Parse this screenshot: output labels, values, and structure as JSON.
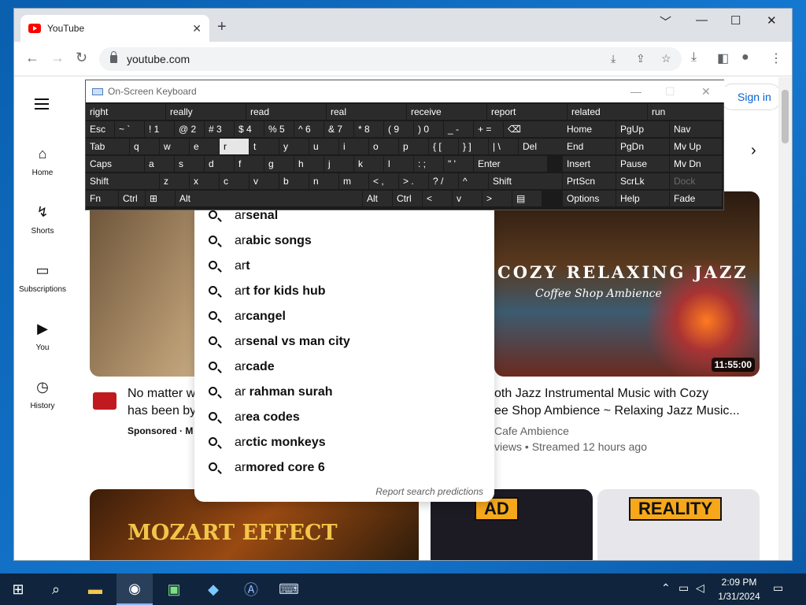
{
  "browser": {
    "tab_title": "YouTube",
    "tab_close": "✕",
    "new_tab": "+",
    "url": "youtube.com",
    "minimize": "﹀",
    "restore_down": "—",
    "maximize": "☐",
    "close": "✕"
  },
  "youtube": {
    "sign_in": "Sign in",
    "sidebar": [
      {
        "label": "Home",
        "icon": "home-icon"
      },
      {
        "label": "Shorts",
        "icon": "shorts-icon"
      },
      {
        "label": "Subscriptions",
        "icon": "subscriptions-icon"
      },
      {
        "label": "You",
        "icon": "you-icon"
      },
      {
        "label": "History",
        "icon": "history-icon"
      }
    ],
    "videos": [
      {
        "title_line1": "No matter w",
        "title_line2": "has been by",
        "meta": "Sponsored · M"
      },
      {
        "thumb_title": "COZY RELAXING JAZZ",
        "thumb_sub": "Coffee Shop Ambience",
        "duration": "11:55:00",
        "title_line1": "oth Jazz Instrumental Music with Cozy",
        "title_line2": "ee Shop Ambience ~ Relaxing Jazz Music...",
        "channel": "Cafe Ambience",
        "meta": "views • Streamed 12 hours ago"
      },
      {
        "thumb_text": "MOZART EFFECT"
      },
      {
        "badge": "AD"
      },
      {
        "badge": "REALITY"
      }
    ],
    "suggestions": [
      {
        "typed": "ar",
        "rest": "senal"
      },
      {
        "typed": "ar",
        "rest": "abic songs"
      },
      {
        "typed": "ar",
        "rest": "t"
      },
      {
        "typed": "ar",
        "rest": "t for kids hub"
      },
      {
        "typed": "ar",
        "rest": "cangel"
      },
      {
        "typed": "ar",
        "rest": "senal vs man city"
      },
      {
        "typed": "ar",
        "rest": "cade"
      },
      {
        "typed": "ar",
        "rest": " rahman surah"
      },
      {
        "typed": "ar",
        "rest": "ea codes"
      },
      {
        "typed": "ar",
        "rest": "ctic monkeys"
      },
      {
        "typed": "ar",
        "rest": "mored core 6"
      }
    ],
    "report": "Report search predictions"
  },
  "osk": {
    "title": "On-Screen Keyboard",
    "predictions": [
      "right",
      "really",
      "read",
      "real",
      "receive",
      "report",
      "related",
      "run"
    ],
    "row1": [
      "Esc",
      "~ `",
      "! 1",
      "@ 2",
      "# 3",
      "$ 4",
      "% 5",
      "^ 6",
      "& 7",
      "* 8",
      "( 9",
      ") 0",
      "_ -",
      "+ =",
      "⌫"
    ],
    "row2": [
      "Tab",
      "q",
      "w",
      "e",
      "r",
      "t",
      "y",
      "u",
      "i",
      "o",
      "p",
      "{ [",
      "} ]",
      "| \\",
      "Del"
    ],
    "row3": [
      "Caps",
      "a",
      "s",
      "d",
      "f",
      "g",
      "h",
      "j",
      "k",
      "l",
      ": ;",
      "\" '",
      "Enter"
    ],
    "row4": [
      "Shift",
      "z",
      "x",
      "c",
      "v",
      "b",
      "n",
      "m",
      "< ,",
      "> .",
      "? /",
      "^",
      "Shift"
    ],
    "row5": [
      "Fn",
      "Ctrl",
      "⊞",
      "Alt",
      "Alt",
      "Ctrl",
      "<",
      "v",
      ">",
      "▤"
    ],
    "nav": [
      [
        "Home",
        "PgUp",
        "Nav"
      ],
      [
        "End",
        "PgDn",
        "Mv Up"
      ],
      [
        "Insert",
        "Pause",
        "Mv Dn"
      ],
      [
        "PrtScn",
        "ScrLk",
        "Dock"
      ],
      [
        "Options",
        "Help",
        "Fade"
      ]
    ]
  },
  "taskbar": {
    "time": "2:09 PM",
    "date": "1/31/2024"
  }
}
